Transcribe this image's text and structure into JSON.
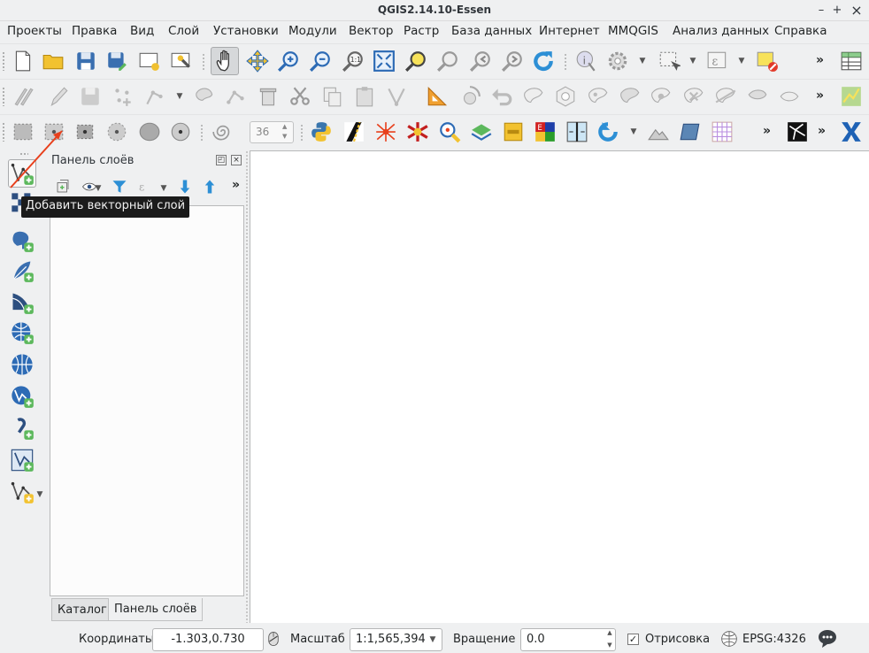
{
  "window": {
    "title": "QGIS2.14.10-Essen",
    "minimize": "–",
    "maximize": "+",
    "close": "×"
  },
  "menu": [
    "Проекты",
    "Правка",
    "Вид",
    "Слой",
    "Установки",
    "Модули",
    "Вектор",
    "Растр",
    "База данных",
    "Интернет",
    "MMQGIS",
    "Анализ данных",
    "Справка"
  ],
  "toolbar_more": "»",
  "buffer_segments": "36",
  "layers_panel": {
    "title": "Панель слоёв",
    "tabs": [
      "Каталог",
      "Панель слоёв"
    ]
  },
  "tooltip": "Добавить векторный слой",
  "statusbar": {
    "coordinates_label": "Координаты",
    "coordinates_value": "-1.303,0.730",
    "scale_label": "Масштаб",
    "scale_value": "1:1,565,394",
    "rotation_label": "Вращение",
    "rotation_value": "0.0",
    "render_label": "Отрисовка",
    "render_checked": true,
    "crs": "EPSG:4326"
  },
  "colors": {
    "window_bg": "#eff0f1",
    "canvas": "#ffffff",
    "tooltip_bg": "#1b1b1b",
    "annotation_arrow": "#e8401c",
    "qgis_green": "#5cb85c"
  }
}
